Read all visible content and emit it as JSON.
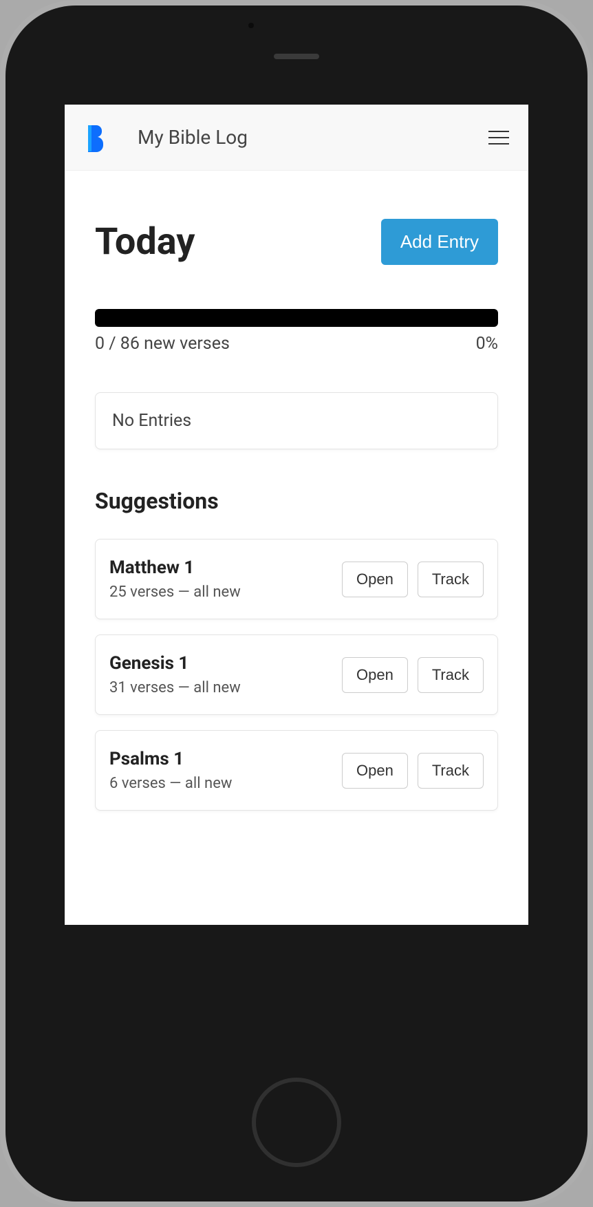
{
  "navbar": {
    "brand": "My Bible Log"
  },
  "header": {
    "greeting": "Today",
    "add_button": "Add Entry"
  },
  "progress": {
    "label": "0 / 86 new verses",
    "percent": "0%"
  },
  "entries": {
    "empty_label": "No Entries"
  },
  "suggestions": {
    "title": "Suggestions",
    "open_label": "Open",
    "track_label": "Track",
    "items": [
      {
        "title": "Matthew 1",
        "sub": "25 verses — all new"
      },
      {
        "title": "Genesis 1",
        "sub": "31 verses — all new"
      },
      {
        "title": "Psalms 1",
        "sub": "6 verses — all new"
      }
    ]
  }
}
